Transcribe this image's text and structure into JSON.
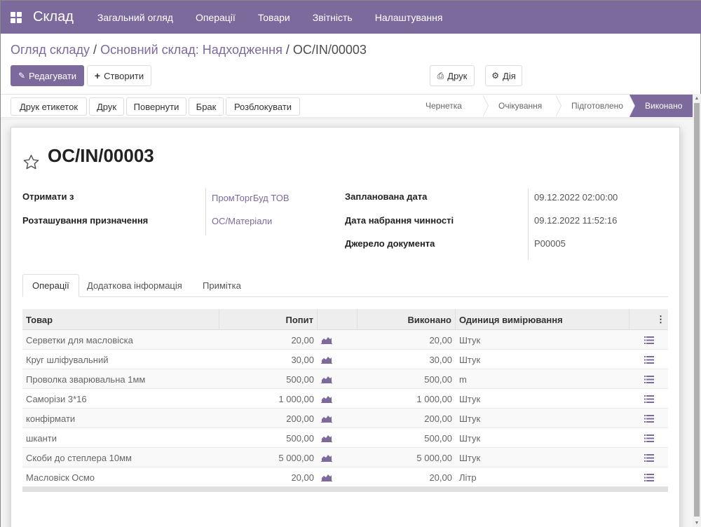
{
  "navbar": {
    "app_name": "Склад",
    "menu": [
      "Загальний огляд",
      "Операції",
      "Товари",
      "Звітність",
      "Налаштування"
    ]
  },
  "breadcrumb": {
    "parts": [
      "Огляд складу",
      "Основний склад: Надходження"
    ],
    "current": "OC/IN/00003"
  },
  "buttons": {
    "edit": "Редагувати",
    "create": "Створити",
    "print": "Друк",
    "action": "Дія"
  },
  "statusbar": {
    "actions": [
      "Друк етикеток",
      "Друк",
      "Повернути",
      "Брак",
      "Розблокувати"
    ],
    "stages": [
      "Чернетка",
      "Очікування",
      "Підготовлено",
      "Виконано"
    ],
    "active_stage": "Виконано"
  },
  "record": {
    "title": "OC/IN/00003",
    "fields_left": [
      {
        "label": "Отримати з",
        "value": "ПромТоргБуд ТОВ"
      },
      {
        "label": "Розташування призначення",
        "value": "OC/Матеріали"
      }
    ],
    "fields_right": [
      {
        "label": "Запланована дата",
        "value": "09.12.2022 02:00:00"
      },
      {
        "label": "Дата набрання чинності",
        "value": "09.12.2022 11:52:16"
      },
      {
        "label": "Джерело документа",
        "value": "P00005"
      }
    ]
  },
  "tabs": [
    "Операції",
    "Додаткова інформація",
    "Примітка"
  ],
  "table": {
    "headers": [
      "Товар",
      "Попит",
      "",
      "Виконано",
      "Одиниця вимірювання",
      "⋮"
    ],
    "rows": [
      {
        "product": "Серветки для масловіска",
        "demand": "20,00",
        "done": "20,00",
        "uom": "Штук"
      },
      {
        "product": "Круг шліфувальний",
        "demand": "30,00",
        "done": "30,00",
        "uom": "Штук"
      },
      {
        "product": "Проволка зварювальна 1мм",
        "demand": "500,00",
        "done": "500,00",
        "uom": "m"
      },
      {
        "product": "Саморізи 3*16",
        "demand": "1 000,00",
        "done": "1 000,00",
        "uom": "Штук"
      },
      {
        "product": "конфірмати",
        "demand": "200,00",
        "done": "200,00",
        "uom": "Штук"
      },
      {
        "product": "шканти",
        "demand": "500,00",
        "done": "500,00",
        "uom": "Штук"
      },
      {
        "product": "Скоби до степлера 10мм",
        "demand": "5 000,00",
        "done": "5 000,00",
        "uom": "Штук"
      },
      {
        "product": "Масловіск Осмо",
        "demand": "20,00",
        "done": "20,00",
        "uom": "Літр"
      }
    ]
  }
}
